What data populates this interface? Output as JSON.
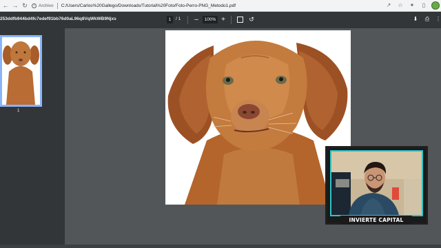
{
  "browser": {
    "archivo_label": "Archivo",
    "url": "C:/Users/Carlos%20Gallego/Downloads/Tutorial%20Foto/Foto-Perro-PNG_Metodo1.pdf"
  },
  "pdf_toolbar": {
    "doc_title": "253ddfb944bd4fc7edef91bb76d0aL96q8VqWkWB9Njxs",
    "current_page": "1",
    "page_total": "/  1",
    "zoom": "100%",
    "zoom_minus": "–",
    "zoom_plus": "+"
  },
  "sidebar": {
    "thumb_number": "1"
  },
  "webcam": {
    "label": "INVIERTE CAPITAL"
  },
  "colors": {
    "pdf_toolbar_bg": "#323639",
    "viewer_bg": "#525659",
    "thumb_border": "#8ab4f8",
    "webcam_accent": "#2ec4c6"
  }
}
